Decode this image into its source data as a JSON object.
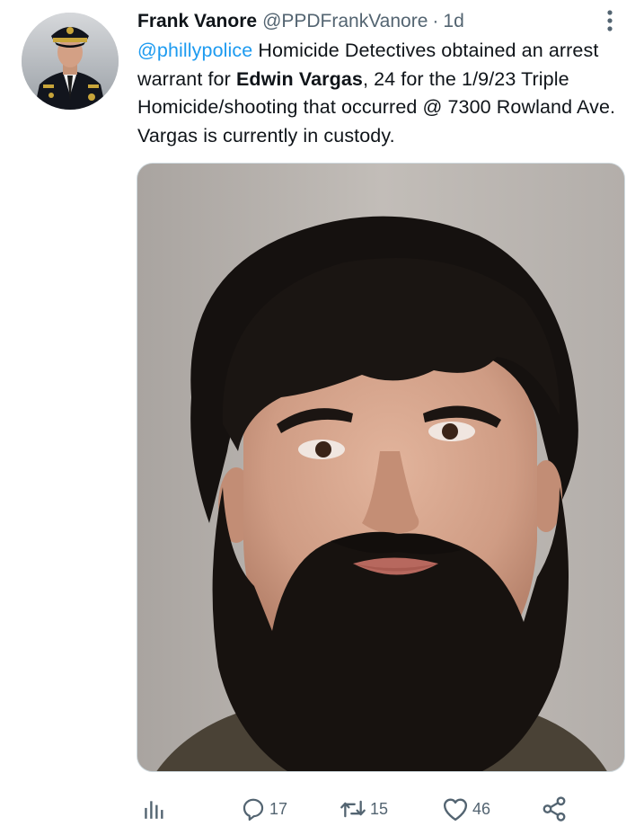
{
  "tweet": {
    "author_name": "Frank Vanore",
    "author_handle": "@PPDFrankVanore",
    "separator": "·",
    "timestamp": "1d",
    "text": {
      "mention": "@phillypolice",
      "part1": " Homicide Detectives obtained an arrest warrant for ",
      "bold_name": "Edwin Vargas",
      "part2": ", 24 for the 1/9/23 Triple Homicide/shooting that occurred @ 7300 Rowland Ave. Vargas is currently in custody."
    },
    "media": {
      "alt": "Booking photo of a young man with dark hair and a full beard against a gray background"
    }
  },
  "actions": {
    "views_icon": "analytics-icon",
    "reply_icon": "reply-icon",
    "reply_count": "17",
    "retweet_icon": "retweet-icon",
    "retweet_count": "15",
    "like_icon": "heart-icon",
    "like_count": "46",
    "share_icon": "share-icon"
  },
  "colors": {
    "link": "#1d9bf0",
    "secondary_text": "#536471",
    "primary_text": "#0f1419"
  }
}
